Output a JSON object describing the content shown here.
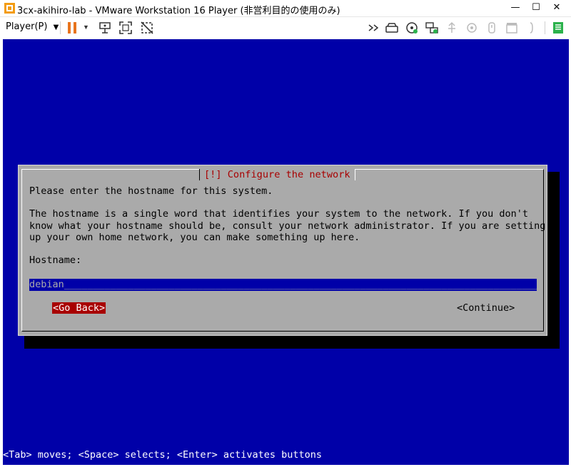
{
  "window": {
    "title": "3cx-akihiro-lab - VMware Workstation 16 Player (非営利目的の使用のみ)",
    "minimize": "—",
    "maximize": "☐",
    "close": "✕"
  },
  "toolbar": {
    "player_menu": "Player(P)",
    "icons": [
      "pause-icon",
      "send-ctrl-alt-del-icon",
      "fullscreen-icon",
      "unity-icon",
      "forward-icon",
      "removable-device-icon",
      "cd-icon",
      "network-icon",
      "usb-icon",
      "sound-icon",
      "printer-icon",
      "message-log-icon",
      "notes-icon"
    ]
  },
  "installer": {
    "dialog_title": "[!] Configure the network",
    "prompt": "Please enter the hostname for this system.",
    "description": [
      "The hostname is a single word that identifies your system to the network. If you don't",
      "know what your hostname should be, consult your network administrator. If you are setting",
      "up your own home network, you can make something up here."
    ],
    "field_label": "Hostname:",
    "hostname_value": "debian",
    "back_button": "<Go Back>",
    "continue_button": "<Continue>",
    "status_line": "<Tab> moves; <Space> selects; <Enter> activates buttons"
  },
  "colors": {
    "console_background": "#0000a8",
    "dialog_background": "#aaaaaa",
    "title_red": "#a80000",
    "selected_button": "#a80000",
    "toolbar_accent": "#e8741d"
  }
}
